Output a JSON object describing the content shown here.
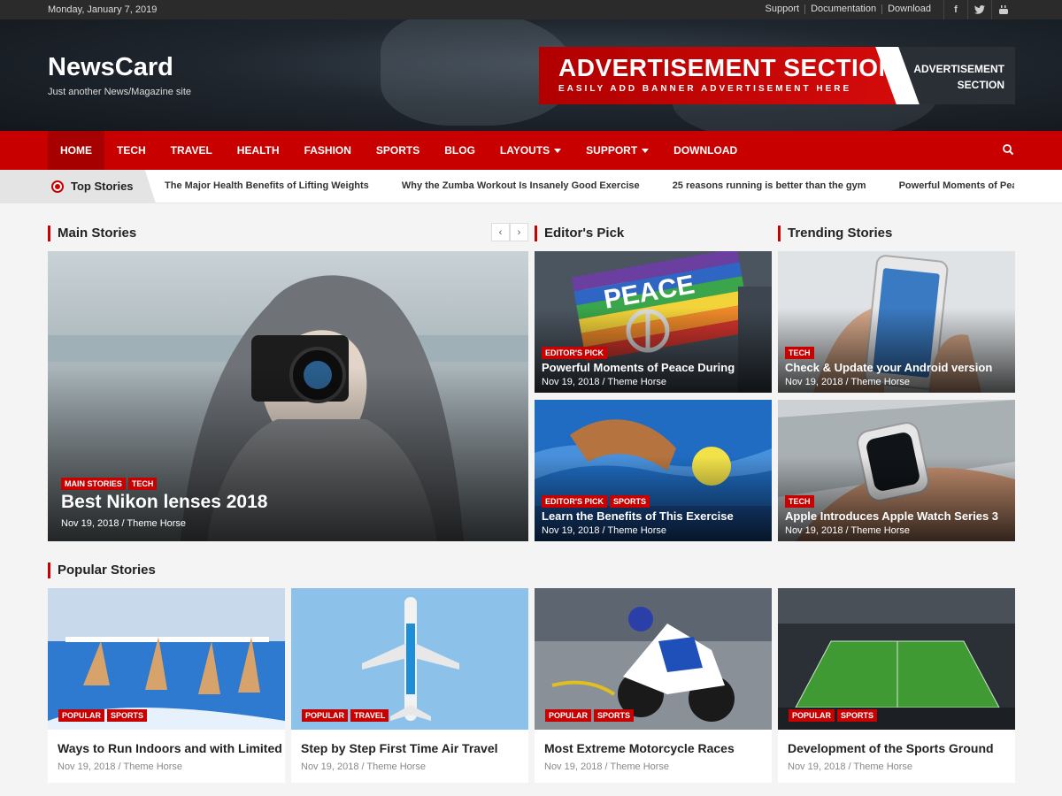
{
  "topbar": {
    "date": "Monday, January 7, 2019",
    "links": [
      "Support",
      "Documentation",
      "Download"
    ],
    "social": [
      "facebook-icon",
      "twitter-icon",
      "youtube-icon"
    ]
  },
  "header": {
    "site_title": "NewsCard",
    "site_description": "Just another News/Magazine site",
    "ad": {
      "title": "ADVERTISEMENT SECTION",
      "subtitle": "EASILY ADD BANNER ADVERTISEMENT HERE",
      "right_line1": "ADVERTISEMENT",
      "right_line2": "SECTION"
    }
  },
  "nav": {
    "items": [
      {
        "label": "HOME",
        "active": true
      },
      {
        "label": "TECH"
      },
      {
        "label": "TRAVEL"
      },
      {
        "label": "HEALTH"
      },
      {
        "label": "FASHION"
      },
      {
        "label": "SPORTS"
      },
      {
        "label": "BLOG"
      },
      {
        "label": "LAYOUTS",
        "dropdown": true
      },
      {
        "label": "SUPPORT",
        "dropdown": true
      },
      {
        "label": "DOWNLOAD"
      }
    ],
    "search_icon": "search-icon"
  },
  "ticker": {
    "label": "Top Stories",
    "items": [
      "The Major Health Benefits of Lifting Weights",
      "Why the Zumba Workout Is Insanely Good Exercise",
      "25 reasons running is better than the gym",
      "Powerful Moments of Peace During"
    ]
  },
  "sections": {
    "main": "Main Stories",
    "editors": "Editor's Pick",
    "trending": "Trending Stories",
    "popular": "Popular Stories"
  },
  "main_story": {
    "tags": [
      "MAIN STORIES",
      "TECH"
    ],
    "title": "Best Nikon lenses 2018",
    "meta": "Nov 19, 2018 / Theme Horse"
  },
  "editors_pick": [
    {
      "tags": [
        "EDITOR'S PICK"
      ],
      "title": "Powerful Moments of Peace During",
      "meta": "Nov 19, 2018 / Theme Horse",
      "sign": "PEACE"
    },
    {
      "tags": [
        "EDITOR'S PICK",
        "SPORTS"
      ],
      "title": "Learn the Benefits of This Exercise",
      "meta": "Nov 19, 2018 / Theme Horse"
    }
  ],
  "trending": [
    {
      "tags": [
        "TECH"
      ],
      "title": "Check & Update your Android version",
      "meta": "Nov 19, 2018 / Theme Horse"
    },
    {
      "tags": [
        "TECH"
      ],
      "title": "Apple Introduces Apple Watch Series 3",
      "meta": "Nov 19, 2018 / Theme Horse"
    }
  ],
  "popular": [
    {
      "tags": [
        "POPULAR",
        "SPORTS"
      ],
      "title": "Ways to Run Indoors and with Limited",
      "meta": "Nov 19, 2018 / Theme Horse"
    },
    {
      "tags": [
        "POPULAR",
        "TRAVEL"
      ],
      "title": "Step by Step First Time Air Travel",
      "meta": "Nov 19, 2018 / Theme Horse"
    },
    {
      "tags": [
        "POPULAR",
        "SPORTS"
      ],
      "title": "Most Extreme Motorcycle Races",
      "meta": "Nov 19, 2018 / Theme Horse"
    },
    {
      "tags": [
        "POPULAR",
        "SPORTS"
      ],
      "title": "Development of the Sports Ground",
      "meta": "Nov 19, 2018 / Theme Horse"
    }
  ],
  "colors": {
    "accent": "#c80000",
    "topbar": "#2b2b2b",
    "page_bg": "#f4f4f4"
  }
}
